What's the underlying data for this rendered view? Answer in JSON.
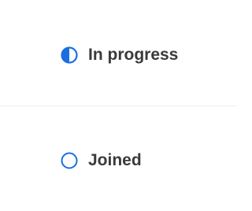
{
  "statuses": [
    {
      "label": "In progress",
      "icon": "half-filled-circle-icon",
      "color": "#1a6fe0"
    },
    {
      "label": "Joined",
      "icon": "empty-circle-icon",
      "color": "#1a6fe0"
    }
  ]
}
